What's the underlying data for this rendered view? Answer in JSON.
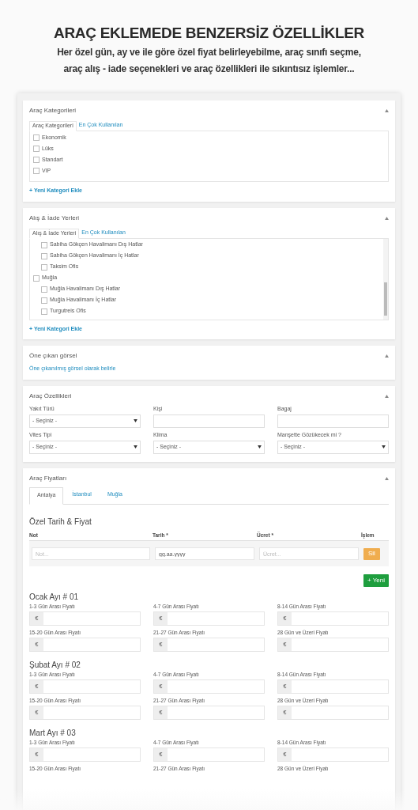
{
  "header": {
    "title": "ARAÇ EKLEMEDE BENZERSİZ ÖZELLİKLER",
    "subtitle": "Her özel gün, ay ve ile göre özel fiyat belirleyebilme, araç sınıfı seçme, araç alış - iade seçenekleri ve araç özellikleri ile sıkıntısız işlemler..."
  },
  "panels": [
    {
      "kind": "taxonomy",
      "title": "Araç Kategorileri",
      "scrollbar": false,
      "tabs": [
        {
          "label": "Araç Kategorileri",
          "selected": true
        },
        {
          "label": "En Çok Kullanılan",
          "selected": false
        }
      ],
      "items": [
        {
          "label": "Ekonomik",
          "checked": false
        },
        {
          "label": "Lüks",
          "checked": false
        },
        {
          "label": "Standart",
          "checked": false
        },
        {
          "label": "VIP",
          "checked": false
        }
      ],
      "add_link": "+ Yeni Kategori Ekle"
    },
    {
      "kind": "taxonomy",
      "title": "Alış & İade Yerleri",
      "scrollbar": true,
      "tabs": [
        {
          "label": "Alış & İade Yerleri",
          "selected": true
        },
        {
          "label": "En Çok Kullanılan",
          "selected": false
        }
      ],
      "items": [
        {
          "children": [
            {
              "label": "Sabiha Gökçen Havalimanı Dış Hatlar",
              "checked": false
            },
            {
              "label": "Sabiha Gökçen Havalimanı İç Hatlar",
              "checked": false
            },
            {
              "label": "Taksim Ofis",
              "checked": false
            }
          ]
        },
        {
          "label": "Muğla",
          "checked": false,
          "children": [
            {
              "label": "Muğla Havalimanı Dış Hatlar",
              "checked": false
            },
            {
              "label": "Muğla Havalimanı İç Hatlar",
              "checked": false
            },
            {
              "label": "Turgutreis Ofis",
              "checked": false
            }
          ]
        }
      ],
      "add_link": "+ Yeni Kategori Ekle"
    },
    {
      "kind": "featured_image",
      "title": "Öne çıkan görsel",
      "link": "Öne çıkanılmış görsel olarak belirle"
    },
    {
      "kind": "fields",
      "title": "Araç Özellikleri",
      "fields": [
        {
          "label": "Yakıt Türü",
          "kind": "select",
          "value": "- Seçiniz -"
        },
        {
          "label": "Kişi",
          "kind": "text"
        },
        {
          "label": "Bagaj",
          "kind": "text"
        },
        {
          "label": "Vites Tipi",
          "kind": "select",
          "value": "- Seçiniz -"
        },
        {
          "label": "Klima",
          "kind": "select",
          "value": "- Seçiniz -"
        },
        {
          "label": "Manşette Gözükecek mi ?",
          "kind": "select",
          "value": "- Seçiniz -"
        }
      ]
    },
    {
      "kind": "prices",
      "title": "Araç Fiyatları",
      "tabs": [
        {
          "label": "Antalya",
          "selected": true
        },
        {
          "label": "İstanbul",
          "selected": false
        },
        {
          "label": "Muğla",
          "selected": false
        }
      ],
      "section_title": "Özel Tarih & Fiyat",
      "columns": [
        "Not",
        "Tarih *",
        "Ücret *",
        "İşlem"
      ],
      "row": {
        "note_placeholder": "Not...",
        "date_value": "gg.aa.yyyy",
        "price_placeholder": "Ücret...",
        "delete_button": "Sil"
      },
      "add_button": "+ Yeni",
      "months": [
        {
          "title": "Ocak Ayı # 01",
          "fields": [
            {
              "label": "1-3 Gün Arası Fiyatı",
              "prefix": "€"
            },
            {
              "label": "4-7 Gün Arası Fiyatı",
              "prefix": "€"
            },
            {
              "label": "8-14 Gün Arası Fiyatı",
              "prefix": "€"
            },
            {
              "label": "15-20 Gün Arası Fiyatı",
              "prefix": "€"
            },
            {
              "label": "21-27 Gün Arası Fiyatı",
              "prefix": "€"
            },
            {
              "label": "28 Gün ve Üzeri Fiyatı",
              "prefix": "€"
            }
          ]
        },
        {
          "title": "Şubat Ayı # 02",
          "fields": [
            {
              "label": "1-3 Gün Arası Fiyatı",
              "prefix": "€"
            },
            {
              "label": "4-7 Gün Arası Fiyatı",
              "prefix": "€"
            },
            {
              "label": "8-14 Gün Arası Fiyatı",
              "prefix": "€"
            },
            {
              "label": "15-20 Gün Arası Fiyatı",
              "prefix": "€"
            },
            {
              "label": "21-27 Gün Arası Fiyatı",
              "prefix": "€"
            },
            {
              "label": "28 Gün ve Üzeri Fiyatı",
              "prefix": "€"
            }
          ]
        },
        {
          "title": "Mart Ayı # 03",
          "fields": [
            {
              "label": "1-3 Gün Arası Fiyatı",
              "prefix": "€"
            },
            {
              "label": "4-7 Gün Arası Fiyatı",
              "prefix": "€"
            },
            {
              "label": "8-14 Gün Arası Fiyatı",
              "prefix": "€"
            },
            {
              "label": "15-20 Gün Arası Fiyatı"
            },
            {
              "label": "21-27 Gün Arası Fiyatı"
            },
            {
              "label": "28 Gün ve Üzeri Fiyatı"
            }
          ]
        }
      ]
    }
  ]
}
